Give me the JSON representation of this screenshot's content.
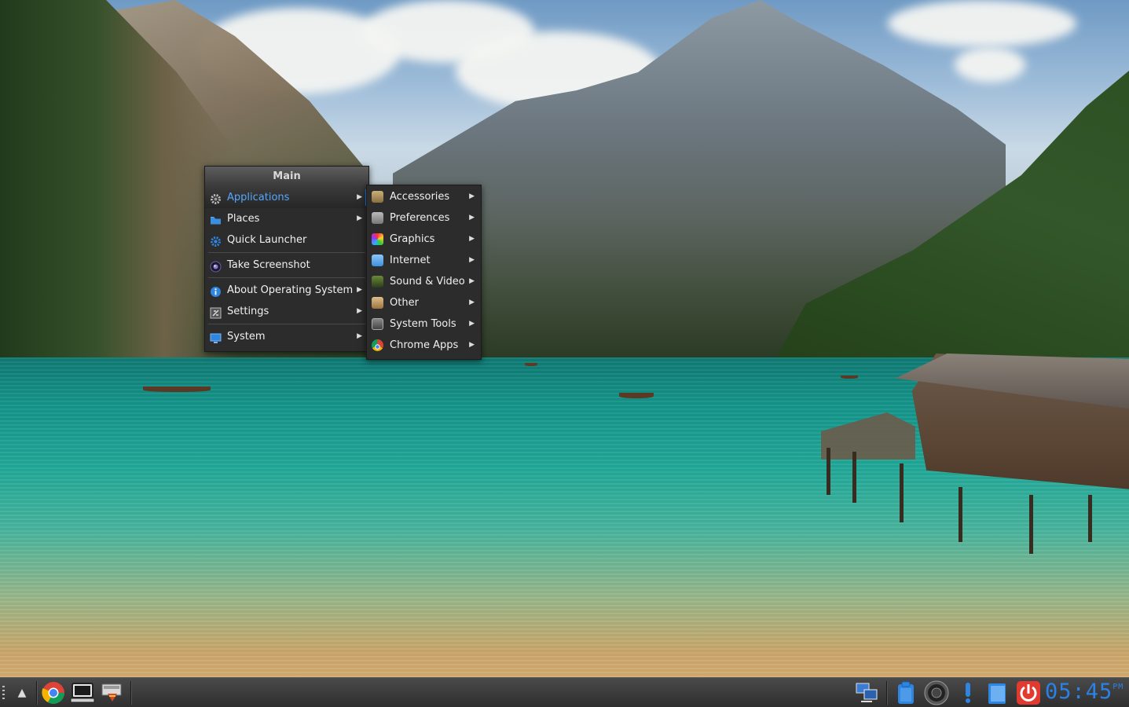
{
  "menu": {
    "title": "Main",
    "items": [
      {
        "label": "Applications",
        "icon": "gear-icon",
        "has_submenu": true,
        "active": true
      },
      {
        "label": "Places",
        "icon": "folder-icon",
        "has_submenu": true
      },
      {
        "label": "Quick Launcher",
        "icon": "gear-blue-icon",
        "has_submenu": false
      },
      {
        "label": "Take Screenshot",
        "icon": "camera-icon",
        "has_submenu": false
      },
      {
        "label": "About Operating System",
        "icon": "info-icon",
        "has_submenu": true
      },
      {
        "label": "Settings",
        "icon": "settings-icon",
        "has_submenu": true
      },
      {
        "label": "System",
        "icon": "system-icon",
        "has_submenu": true
      }
    ]
  },
  "submenu": {
    "items": [
      {
        "label": "Accessories",
        "icon": "accessories-icon"
      },
      {
        "label": "Preferences",
        "icon": "preferences-icon"
      },
      {
        "label": "Graphics",
        "icon": "graphics-icon"
      },
      {
        "label": "Internet",
        "icon": "internet-icon"
      },
      {
        "label": "Sound & Video",
        "icon": "sound-video-icon"
      },
      {
        "label": "Other",
        "icon": "other-icon"
      },
      {
        "label": "System Tools",
        "icon": "system-tools-icon"
      },
      {
        "label": "Chrome Apps",
        "icon": "chrome-icon"
      }
    ]
  },
  "panel": {
    "launchers": [
      "chrome-icon",
      "terminal-icon",
      "file-manager-icon"
    ],
    "tray": [
      "network-icon",
      "clipboard-icon",
      "volume-icon",
      "notification-icon",
      "battery-icon",
      "power-icon"
    ],
    "clock": {
      "time": "05:45",
      "ampm": "PM"
    }
  },
  "colors": {
    "accent": "#1e7cf0",
    "menu_bg": "#2c2c2c",
    "panel_bg": "#3a3a3a",
    "clock": "#2a82e6"
  }
}
